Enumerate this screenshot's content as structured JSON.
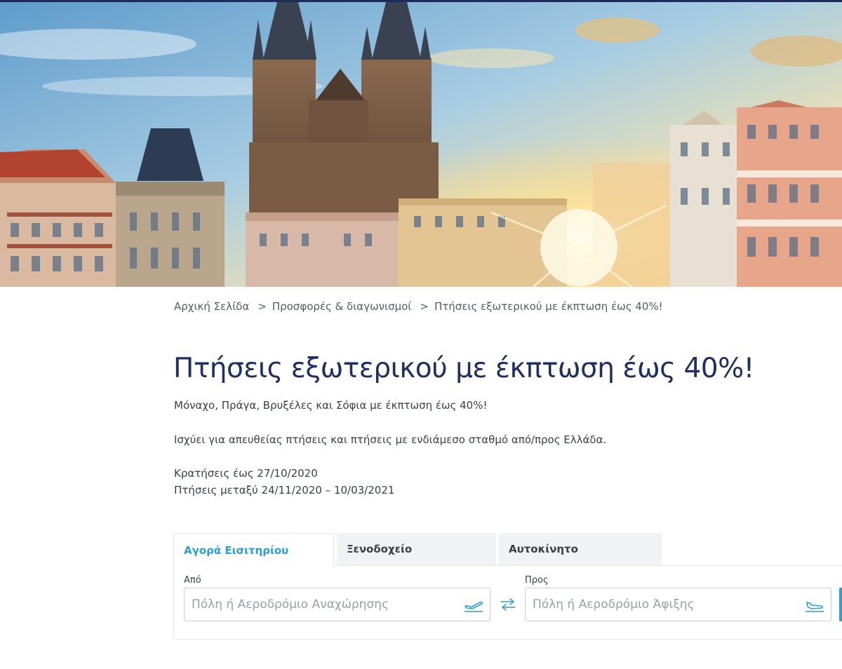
{
  "breadcrumb": {
    "home": "Αρχική Σελίδα",
    "offers": "Προσφορές & διαγωνισμοί",
    "current": "Πτήσεις εξωτερικού με έκπτωση έως 40%!",
    "separator": ">"
  },
  "main": {
    "title": "Πτήσεις εξωτερικού με έκπτωση έως 40%!",
    "line1": "Μόναχο, Πράγα, Βρυξέλες και Σόφια με έκπτωση έως 40%!",
    "line2": "Ισχύει για απευθείας πτήσεις και πτήσεις με ενδιάμεσο σταθμό από/προς Ελλάδα.",
    "line3": "Κρατήσεις έως 27/10/2020",
    "line4": "Πτήσεις μεταξύ 24/11/2020 – 10/03/2021"
  },
  "booking": {
    "tabs": [
      {
        "label": "Αγορά Εισιτηρίου",
        "active": true
      },
      {
        "label": "Ξενοδοχείο",
        "active": false
      },
      {
        "label": "Αυτοκίνητο",
        "active": false
      }
    ],
    "from": {
      "label": "Από",
      "placeholder": "Πόλη ή Αεροδρόμιο Αναχώρησης",
      "value": "",
      "icon": "plane-departure-icon"
    },
    "to": {
      "label": "Προς",
      "placeholder": "Πόλη ή Αεροδρόμιο Άφιξης",
      "value": "",
      "icon": "plane-arrival-icon"
    },
    "swap_icon": "swap-arrows-icon"
  },
  "colors": {
    "title": "#1f2f61",
    "accent": "#2a9fd6",
    "top_strip": "#1f2a5c",
    "tab_inactive_bg": "#f1f2f4"
  }
}
